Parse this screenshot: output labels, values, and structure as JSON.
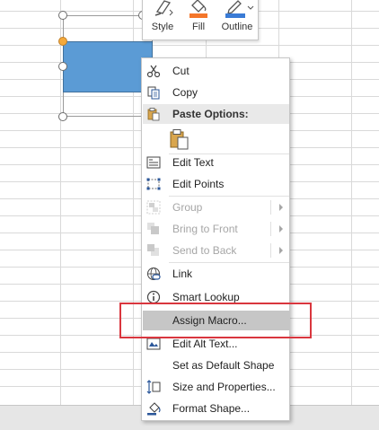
{
  "mini_toolbar": {
    "buttons": [
      {
        "label": "Style",
        "icon": "shape-style-icon"
      },
      {
        "label": "Fill",
        "icon": "fill-bucket-icon",
        "color": "#f4762a"
      },
      {
        "label": "Outline",
        "icon": "pen-outline-icon",
        "color": "#3a7bd5"
      }
    ]
  },
  "context_menu": {
    "items": [
      {
        "label": "Cut",
        "icon": "scissors-icon",
        "enabled": true
      },
      {
        "label": "Copy",
        "icon": "copy-icon",
        "enabled": true
      },
      {
        "label": "Paste Options:",
        "icon": "paste-icon",
        "enabled": true,
        "header": true
      },
      {
        "label": "Edit Text",
        "icon": "edit-text-icon",
        "enabled": true
      },
      {
        "label": "Edit Points",
        "icon": "edit-points-icon",
        "enabled": true
      },
      {
        "label": "Group",
        "icon": "group-icon",
        "enabled": false,
        "submenu": true
      },
      {
        "label": "Bring to Front",
        "icon": "bring-to-front-icon",
        "enabled": false,
        "submenu": true
      },
      {
        "label": "Send to Back",
        "icon": "send-to-back-icon",
        "enabled": false,
        "submenu": true
      },
      {
        "label": "Link",
        "icon": "link-icon",
        "enabled": true
      },
      {
        "label": "Smart Lookup",
        "icon": "smart-lookup-icon",
        "enabled": true
      },
      {
        "label": "Assign Macro...",
        "icon": "",
        "enabled": true,
        "highlighted": true
      },
      {
        "label": "Edit Alt Text...",
        "icon": "alt-text-icon",
        "enabled": true
      },
      {
        "label": "Set as Default Shape",
        "icon": "",
        "enabled": true
      },
      {
        "label": "Size and Properties...",
        "icon": "size-properties-icon",
        "enabled": true
      },
      {
        "label": "Format Shape...",
        "icon": "format-shape-icon",
        "enabled": true
      }
    ]
  },
  "colors": {
    "shape_fill": "#5b9bd5",
    "highlight": "#c6c6c6",
    "annotation": "#d9363e"
  }
}
